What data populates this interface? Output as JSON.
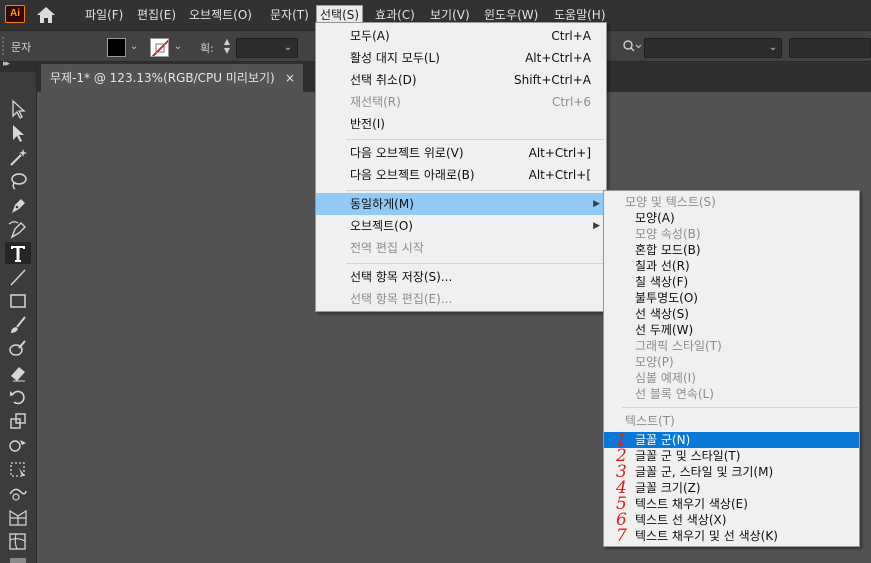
{
  "app": {
    "logo_text": "Ai"
  },
  "menubar": {
    "icons": [
      "home-icon"
    ],
    "items": [
      {
        "label": "파일(F)"
      },
      {
        "label": "편집(E)"
      },
      {
        "label": "오브젝트(O)"
      },
      {
        "label": "문자(T)"
      },
      {
        "label": "선택(S)",
        "active": true
      },
      {
        "label": "효과(C)"
      },
      {
        "label": "보기(V)"
      },
      {
        "label": "윈도우(W)"
      },
      {
        "label": "도움말(H)"
      }
    ]
  },
  "controlbar": {
    "label": "문자",
    "stroke_label": "획:",
    "colors": {
      "fill": "#000000",
      "stroke_none_slash": "#e0211c"
    },
    "search_icon": "search-icon"
  },
  "document_tab": {
    "title": "무제-1* @ 123.13%(RGB/CPU 미리보기)",
    "close_label": "×"
  },
  "tools": [
    "selection-arrow-icon",
    "direct-selection-icon",
    "magic-wand-icon",
    "lasso-icon",
    "pen-icon",
    "curvature-icon",
    "type-icon",
    "line-segment-icon",
    "rectangle-icon",
    "paintbrush-icon",
    "blob-brush-icon",
    "eraser-icon",
    "rotate-icon",
    "scale-icon",
    "shape-builder-icon",
    "free-transform-icon",
    "warp-icon",
    "perspective-grid-icon",
    "mesh-icon",
    "gradient-icon"
  ],
  "select_menu": {
    "items": [
      {
        "label": "모두(A)",
        "shortcut": "Ctrl+A",
        "disabled": false
      },
      {
        "label": "활성 대지 모두(L)",
        "shortcut": "Alt+Ctrl+A",
        "disabled": false
      },
      {
        "label": "선택 취소(D)",
        "shortcut": "Shift+Ctrl+A",
        "disabled": false
      },
      {
        "label": "재선택(R)",
        "shortcut": "Ctrl+6",
        "disabled": true
      },
      {
        "label": "반전(I)",
        "shortcut": "",
        "disabled": false
      },
      {
        "label": "다음 오브젝트 위로(V)",
        "shortcut": "Alt+Ctrl+]",
        "disabled": false
      },
      {
        "label": "다음 오브젝트 아래로(B)",
        "shortcut": "Alt+Ctrl+[",
        "disabled": false
      },
      {
        "label": "동일하게(M)",
        "shortcut": "",
        "disabled": false,
        "submenu": true,
        "highlighted": true
      },
      {
        "label": "오브젝트(O)",
        "shortcut": "",
        "disabled": false,
        "submenu": true
      },
      {
        "label": "전역 편집 시작",
        "shortcut": "",
        "disabled": true
      },
      {
        "label": "선택 항목 저장(S)...",
        "shortcut": "",
        "disabled": false
      },
      {
        "label": "선택 항목 편집(E)...",
        "shortcut": "",
        "disabled": true
      }
    ]
  },
  "same_submenu": {
    "items": [
      {
        "label": "모양 및 텍스트(S)",
        "kind": "header"
      },
      {
        "label": "모양(A)",
        "disabled": false
      },
      {
        "label": "모양 속성(B)",
        "disabled": true
      },
      {
        "label": "혼합 모드(B)",
        "disabled": false
      },
      {
        "label": "칠과 선(R)",
        "disabled": false
      },
      {
        "label": "칠 색상(F)",
        "disabled": false
      },
      {
        "label": "불투명도(O)",
        "disabled": false
      },
      {
        "label": "선 색상(S)",
        "disabled": false
      },
      {
        "label": "선 두께(W)",
        "disabled": false
      },
      {
        "label": "그래픽 스타일(T)",
        "disabled": true
      },
      {
        "label": "모양(P)",
        "disabled": true
      },
      {
        "label": "심볼 예제(I)",
        "disabled": true
      },
      {
        "label": "선 블록 연속(L)",
        "disabled": true
      },
      {
        "label": "텍스트(T)",
        "kind": "header"
      },
      {
        "label": "글꼴 군(N)",
        "number": "1",
        "highlighted": true
      },
      {
        "label": "글꼴 군 및 스타일(T)",
        "number": "2"
      },
      {
        "label": "글꼴 군, 스타일 및 크기(M)",
        "number": "3"
      },
      {
        "label": "글꼴 크기(Z)",
        "number": "4"
      },
      {
        "label": "텍스트 채우기 색상(E)",
        "number": "5"
      },
      {
        "label": "텍스트 선 색상(X)",
        "number": "6"
      },
      {
        "label": "텍스트 채우기 및 선 색상(K)",
        "number": "7"
      }
    ]
  }
}
